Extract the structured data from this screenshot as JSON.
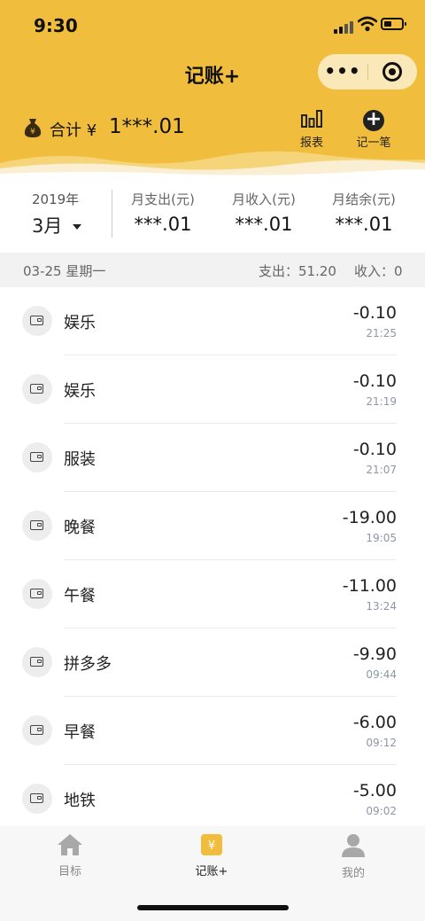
{
  "status_bar": {
    "time": "9:30"
  },
  "header": {
    "title": "记账+",
    "more_label": "•••",
    "total_label": "合计 ¥",
    "total_value": "1***.01",
    "report_label": "报表",
    "add_label": "记一笔",
    "brand_color": "#f1bd3d"
  },
  "summary": {
    "year": "2019年",
    "month": "3月",
    "expense_label": "月支出(元)",
    "expense_value": "***.01",
    "income_label": "月收入(元)",
    "income_value": "***.01",
    "balance_label": "月结余(元)",
    "balance_value": "***.01"
  },
  "day": {
    "date": "03-25 星期一",
    "expense": "支出：51.20",
    "income": "收入：0"
  },
  "entries": [
    {
      "category": "娱乐",
      "amount": "-0.10",
      "time": "21:25",
      "icon": "wallet-icon"
    },
    {
      "category": "娱乐",
      "amount": "-0.10",
      "time": "21:19",
      "icon": "wallet-icon"
    },
    {
      "category": "服装",
      "amount": "-0.10",
      "time": "21:07",
      "icon": "wallet-icon"
    },
    {
      "category": "晚餐",
      "amount": "-19.00",
      "time": "19:05",
      "icon": "wallet-icon"
    },
    {
      "category": "午餐",
      "amount": "-11.00",
      "time": "13:24",
      "icon": "wallet-icon"
    },
    {
      "category": "拼多多",
      "amount": "-9.90",
      "time": "09:44",
      "icon": "wallet-icon"
    },
    {
      "category": "早餐",
      "amount": "-6.00",
      "time": "09:12",
      "icon": "wallet-icon"
    },
    {
      "category": "地铁",
      "amount": "-5.00",
      "time": "09:02",
      "icon": "wallet-icon"
    }
  ],
  "tabbar": {
    "tab1": "目标",
    "tab2": "记账+",
    "tab3": "我的"
  }
}
